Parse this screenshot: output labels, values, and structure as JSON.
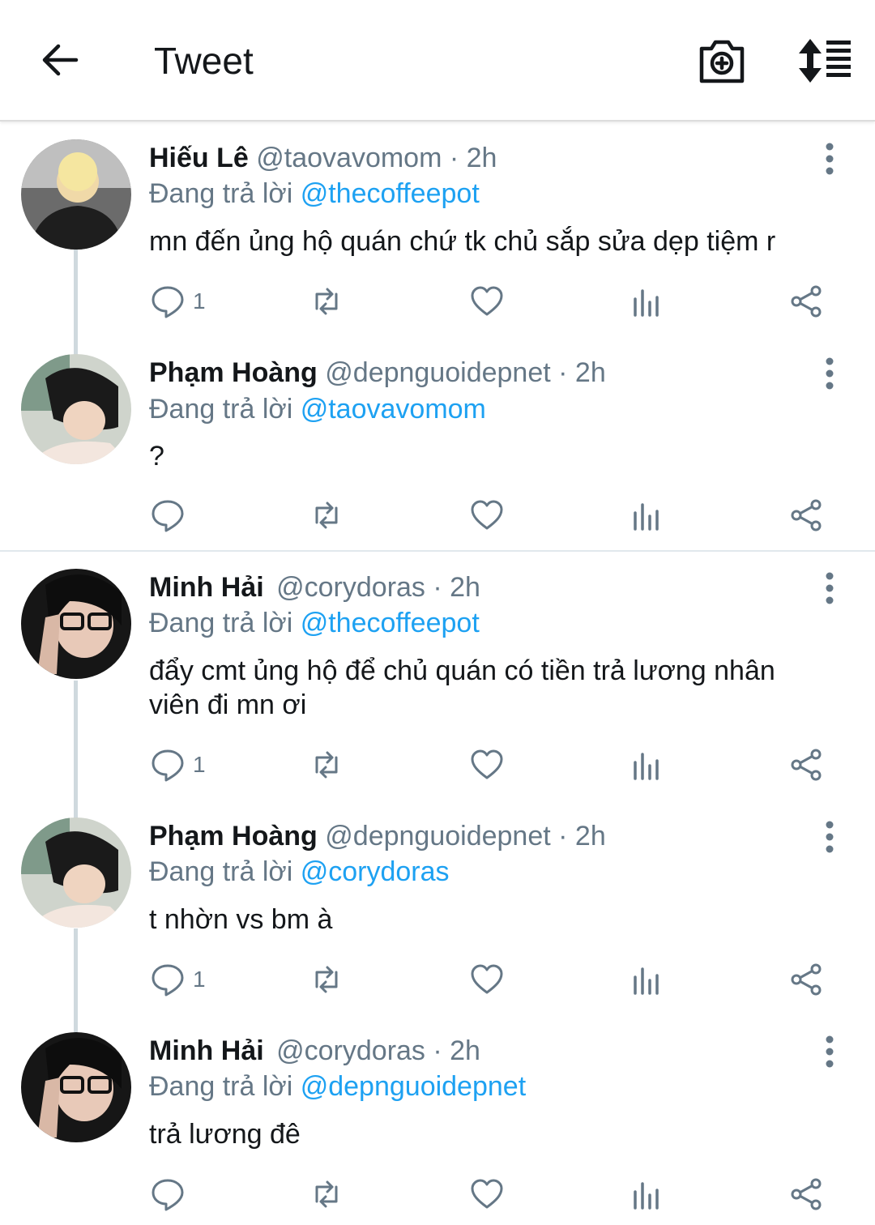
{
  "topbar": {
    "title": "Tweet"
  },
  "colors": {
    "accent": "#1da1f2",
    "muted": "#657786",
    "text": "#14171a"
  },
  "tweets": [
    {
      "name": "Hiếu Lê",
      "handle": "@taovavomom",
      "time": "· 2h",
      "reply_prefix": "Đang trả lời",
      "reply_to": "@thecoffeepot",
      "text": "mn đến ủng hộ quán chứ tk chủ sắp sửa dẹp tiệm r",
      "reply_count": "1"
    },
    {
      "name": "Phạm Hoàng",
      "handle": "@depnguoidepnet",
      "time": "· 2h",
      "reply_prefix": "Đang trả lời",
      "reply_to": "@taovavomom",
      "text": "?",
      "reply_count": ""
    },
    {
      "name": "Minh Hải",
      "handle": "@corydoras",
      "time": "· 2h",
      "reply_prefix": "Đang trả lời",
      "reply_to": "@thecoffeepot",
      "text": "đẩy cmt ủng hộ để chủ quán có tiền trả lương nhân viên đi mn ơi",
      "reply_count": "1"
    },
    {
      "name": "Phạm Hoàng",
      "handle": "@depnguoidepnet",
      "time": "· 2h",
      "reply_prefix": "Đang trả lời",
      "reply_to": "@corydoras",
      "text": "t nhờn vs bm à",
      "reply_count": "1"
    },
    {
      "name": "Minh Hải",
      "handle": "@corydoras",
      "time": "· 2h",
      "reply_prefix": "Đang trả lời",
      "reply_to": "@depnguoidepnet",
      "text": "trả lương đê",
      "reply_count": ""
    }
  ],
  "icons": {
    "topbar": [
      "back-arrow-icon",
      "camera-add-icon",
      "sort-icon"
    ],
    "actions": [
      "reply-icon",
      "retweet-icon",
      "like-icon",
      "analytics-icon",
      "share-icon"
    ],
    "more": "more-vertical-icon"
  }
}
